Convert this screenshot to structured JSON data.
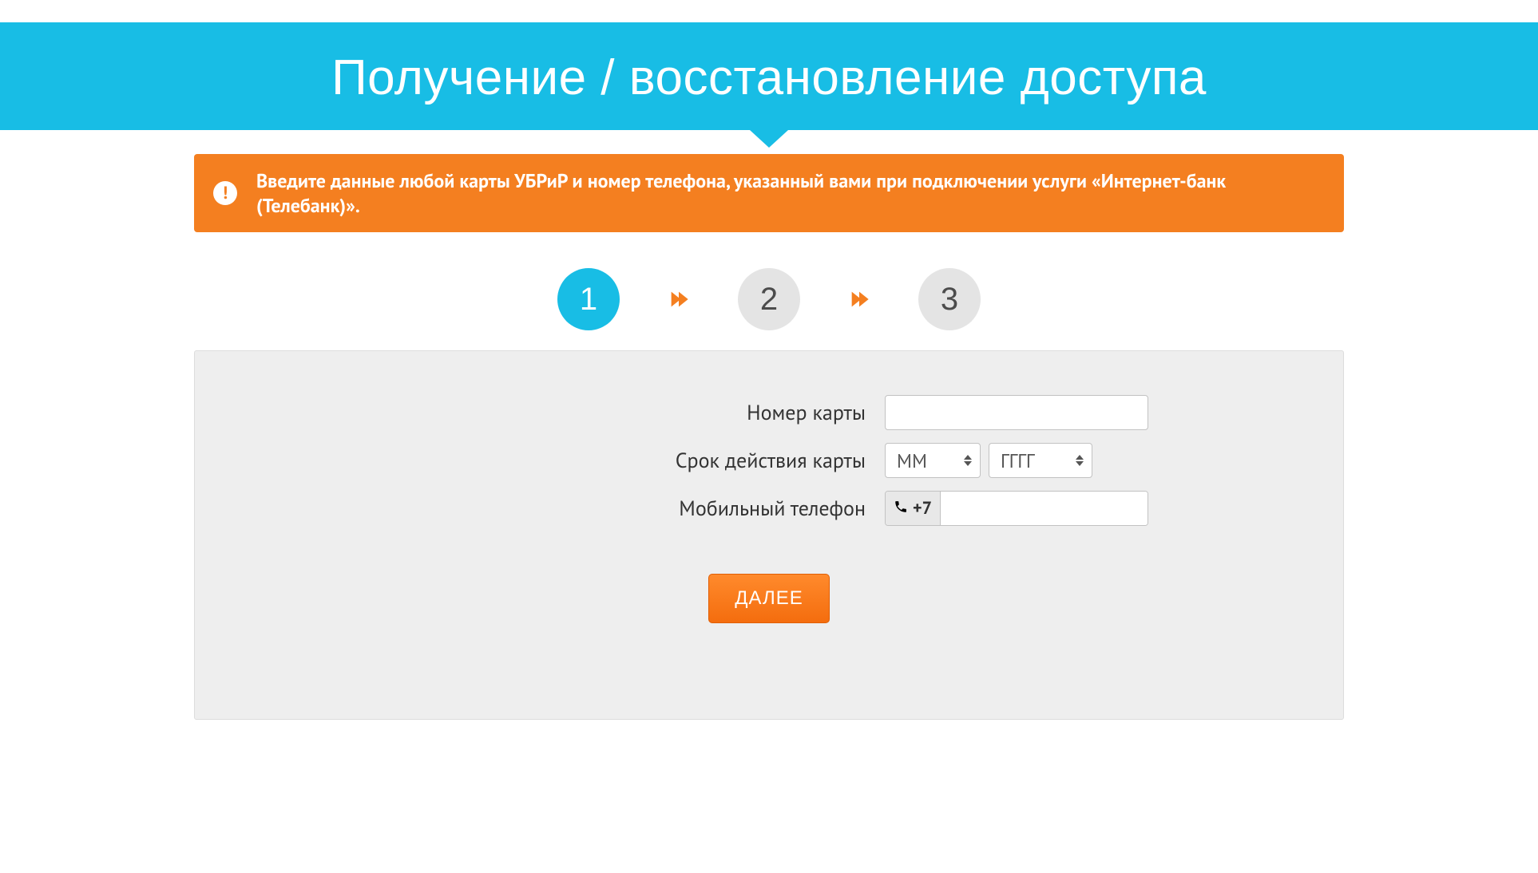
{
  "colors": {
    "banner": "#18bde5",
    "accent": "#f47f20"
  },
  "banner": {
    "title": "Получение / восстановление доступа"
  },
  "notice": {
    "text": "Введите данные любой карты УБРиР и номер телефона, указанный вами при подключении услуги «Интернет-банк (Телебанк)».",
    "icon": "!"
  },
  "steps": {
    "items": [
      {
        "number": "1",
        "active": true
      },
      {
        "number": "2",
        "active": false
      },
      {
        "number": "3",
        "active": false
      }
    ]
  },
  "form": {
    "card_number": {
      "label": "Номер карты",
      "value": ""
    },
    "expiry": {
      "label": "Срок действия карты",
      "month_placeholder": "ММ",
      "year_placeholder": "ГГГГ"
    },
    "phone": {
      "label": "Мобильный телефон",
      "prefix": "+7",
      "value": ""
    },
    "submit_label": "ДАЛЕЕ"
  }
}
